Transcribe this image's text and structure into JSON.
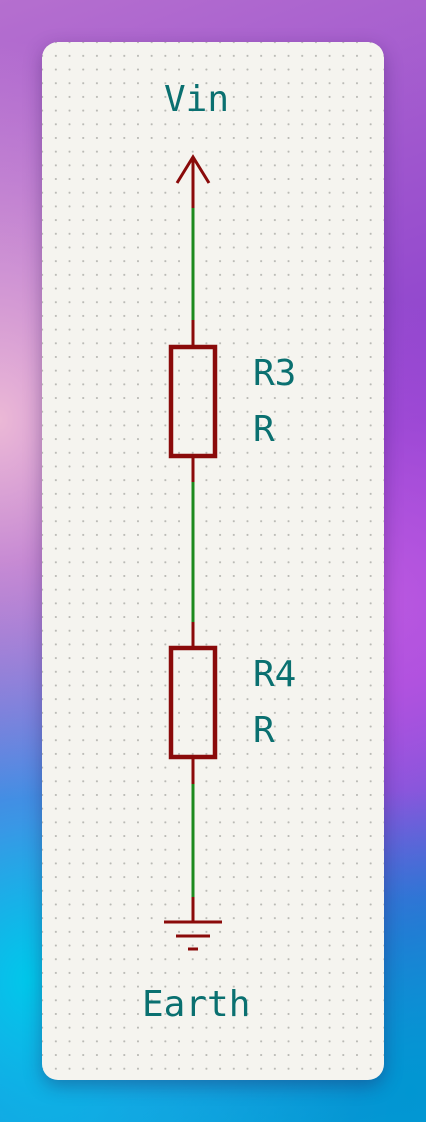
{
  "colors": {
    "wire": "#1d8a1d",
    "component": "#8a0a0a",
    "label": "#0a7070",
    "sheet": "#f5f4ef"
  },
  "nets": {
    "power_label": "Vin",
    "ground_label": "Earth"
  },
  "components": [
    {
      "reference": "R3",
      "value": "R"
    },
    {
      "reference": "R4",
      "value": "R"
    }
  ]
}
